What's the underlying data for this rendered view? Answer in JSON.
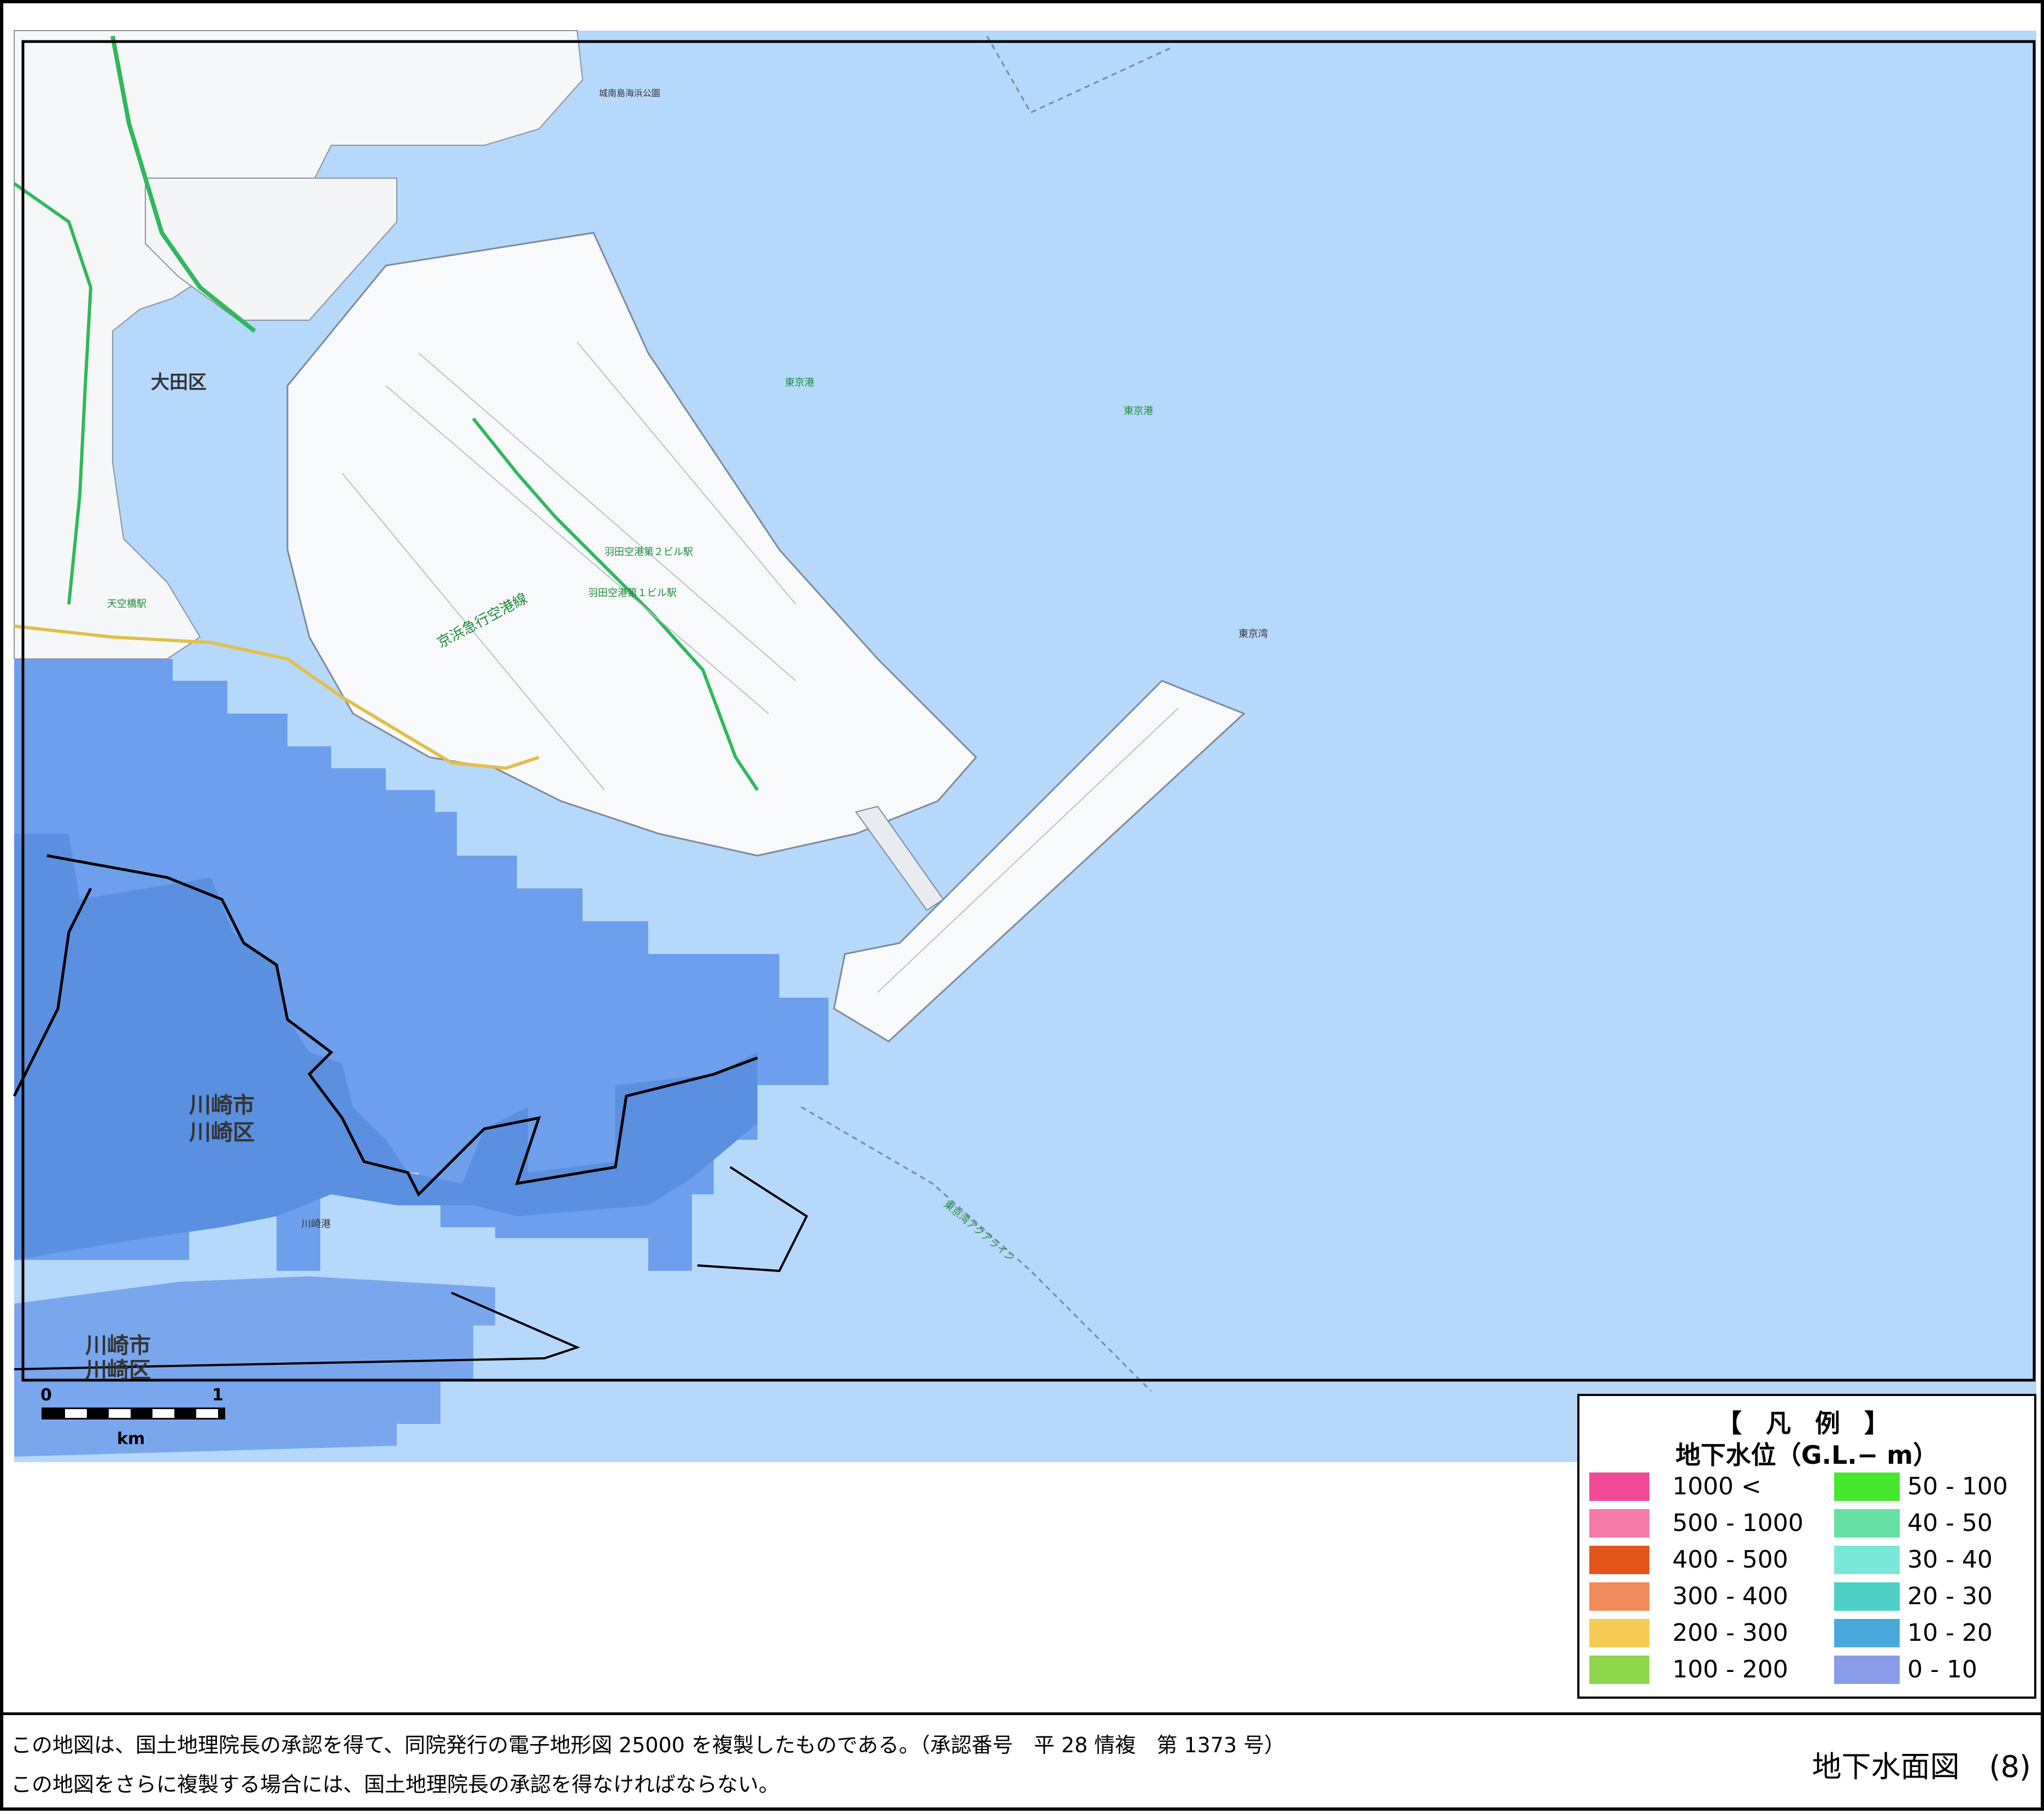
{
  "map": {
    "labels": {
      "ota_ku": "大田区",
      "kawasaki1": "川崎市",
      "kawasaki1b": "川崎区",
      "kawasaki2": "川崎市",
      "kawasaki2b": "川崎区",
      "tokyo_port1": "東京港",
      "tokyo_port2": "東京港",
      "tokyo_bay": "東京湾",
      "keikyu_line": "京浜急行空港線",
      "haneda_t2": "羽田空港第２ビル駅",
      "haneda_t1": "羽田空港第１ビル駅",
      "tenkubashi": "天空橋駅",
      "aqua_line": "東京湾アクアライン",
      "kawasaki_port": "川崎港",
      "jonanjima": "城南島海浜公園"
    }
  },
  "scale": {
    "zero": "0",
    "one": "1",
    "unit": "km"
  },
  "legend": {
    "title": "【 凡 例 】",
    "subtitle": "地下水位（G.L.− m）",
    "items": [
      {
        "label": "1000 <",
        "color": "#f24a96"
      },
      {
        "label": "500 - 1000",
        "color": "#f47aa8"
      },
      {
        "label": "400 - 500",
        "color": "#e4551b"
      },
      {
        "label": "300 - 400",
        "color": "#ef8a5a"
      },
      {
        "label": "200 - 300",
        "color": "#f5cb53"
      },
      {
        "label": "100 - 200",
        "color": "#8ed64b"
      },
      {
        "label": "50 - 100",
        "color": "#45e82c"
      },
      {
        "label": "40 - 50",
        "color": "#66e0a3"
      },
      {
        "label": "30 - 40",
        "color": "#7ae8d8"
      },
      {
        "label": "20 - 30",
        "color": "#4ed0c6"
      },
      {
        "label": "10 - 20",
        "color": "#48a8dc"
      },
      {
        "label": "0 - 10",
        "color": "#8a9ce8"
      }
    ]
  },
  "footer": {
    "note1": "この地図は、国土地理院長の承認を得て、同院発行の電子地形図 25000 を複製したものである。（承認番号　平 28 情複　第 1373 号）",
    "note2": "この地図をさらに複製する場合には、国土地理院長の承認を得なければならない。",
    "title": "地下水面図　(8)"
  }
}
